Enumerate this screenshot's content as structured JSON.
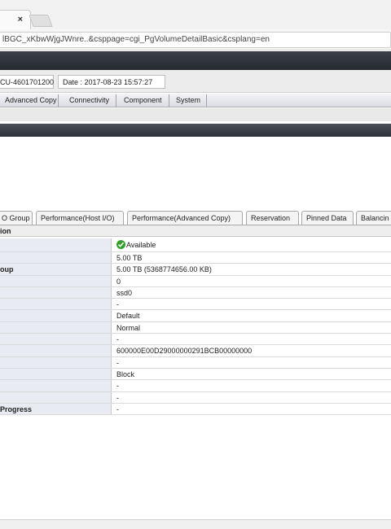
{
  "browser": {
    "tab_close": "×",
    "url": "lBGC_xKbwWjgJWnre..&csppage=cgi_PgVolumeDetailBasic&csplang=en"
  },
  "header": {
    "storage_name": "CU-4601701200",
    "date": "Date : 2017-08-23 15:57:27"
  },
  "menu": [
    "Advanced Copy",
    "Connectivity",
    "Component",
    "System"
  ],
  "tabs": [
    "O Group",
    "Performance(Host I/O)",
    "Performance(Advanced Copy)",
    "Reservation",
    "Pinned Data",
    "Balancin"
  ],
  "section_title": "ion",
  "details": [
    {
      "label": "",
      "value": "Available",
      "icon": "check-circle-icon"
    },
    {
      "label": "",
      "value": "5.00 TB"
    },
    {
      "label": "oup",
      "value": "5.00 TB (5368774656.00 KB)"
    },
    {
      "label": "",
      "value": "0"
    },
    {
      "label": "",
      "value": "ssd0"
    },
    {
      "label": "",
      "value": "-"
    },
    {
      "label": "",
      "value": "Default"
    },
    {
      "label": "",
      "value": "Normal"
    },
    {
      "label": "",
      "value": "-"
    },
    {
      "label": "",
      "value": "600000E00D29000000291BCB00000000"
    },
    {
      "label": "",
      "value": "-"
    },
    {
      "label": "",
      "value": "Block"
    },
    {
      "label": "",
      "value": "-"
    },
    {
      "label": "",
      "value": "-"
    },
    {
      "label": "Progress",
      "value": "-"
    }
  ],
  "colors": {
    "banner": "#2d3137",
    "status_ok": "#33a02c",
    "label_bg": "#e8ebf2"
  }
}
